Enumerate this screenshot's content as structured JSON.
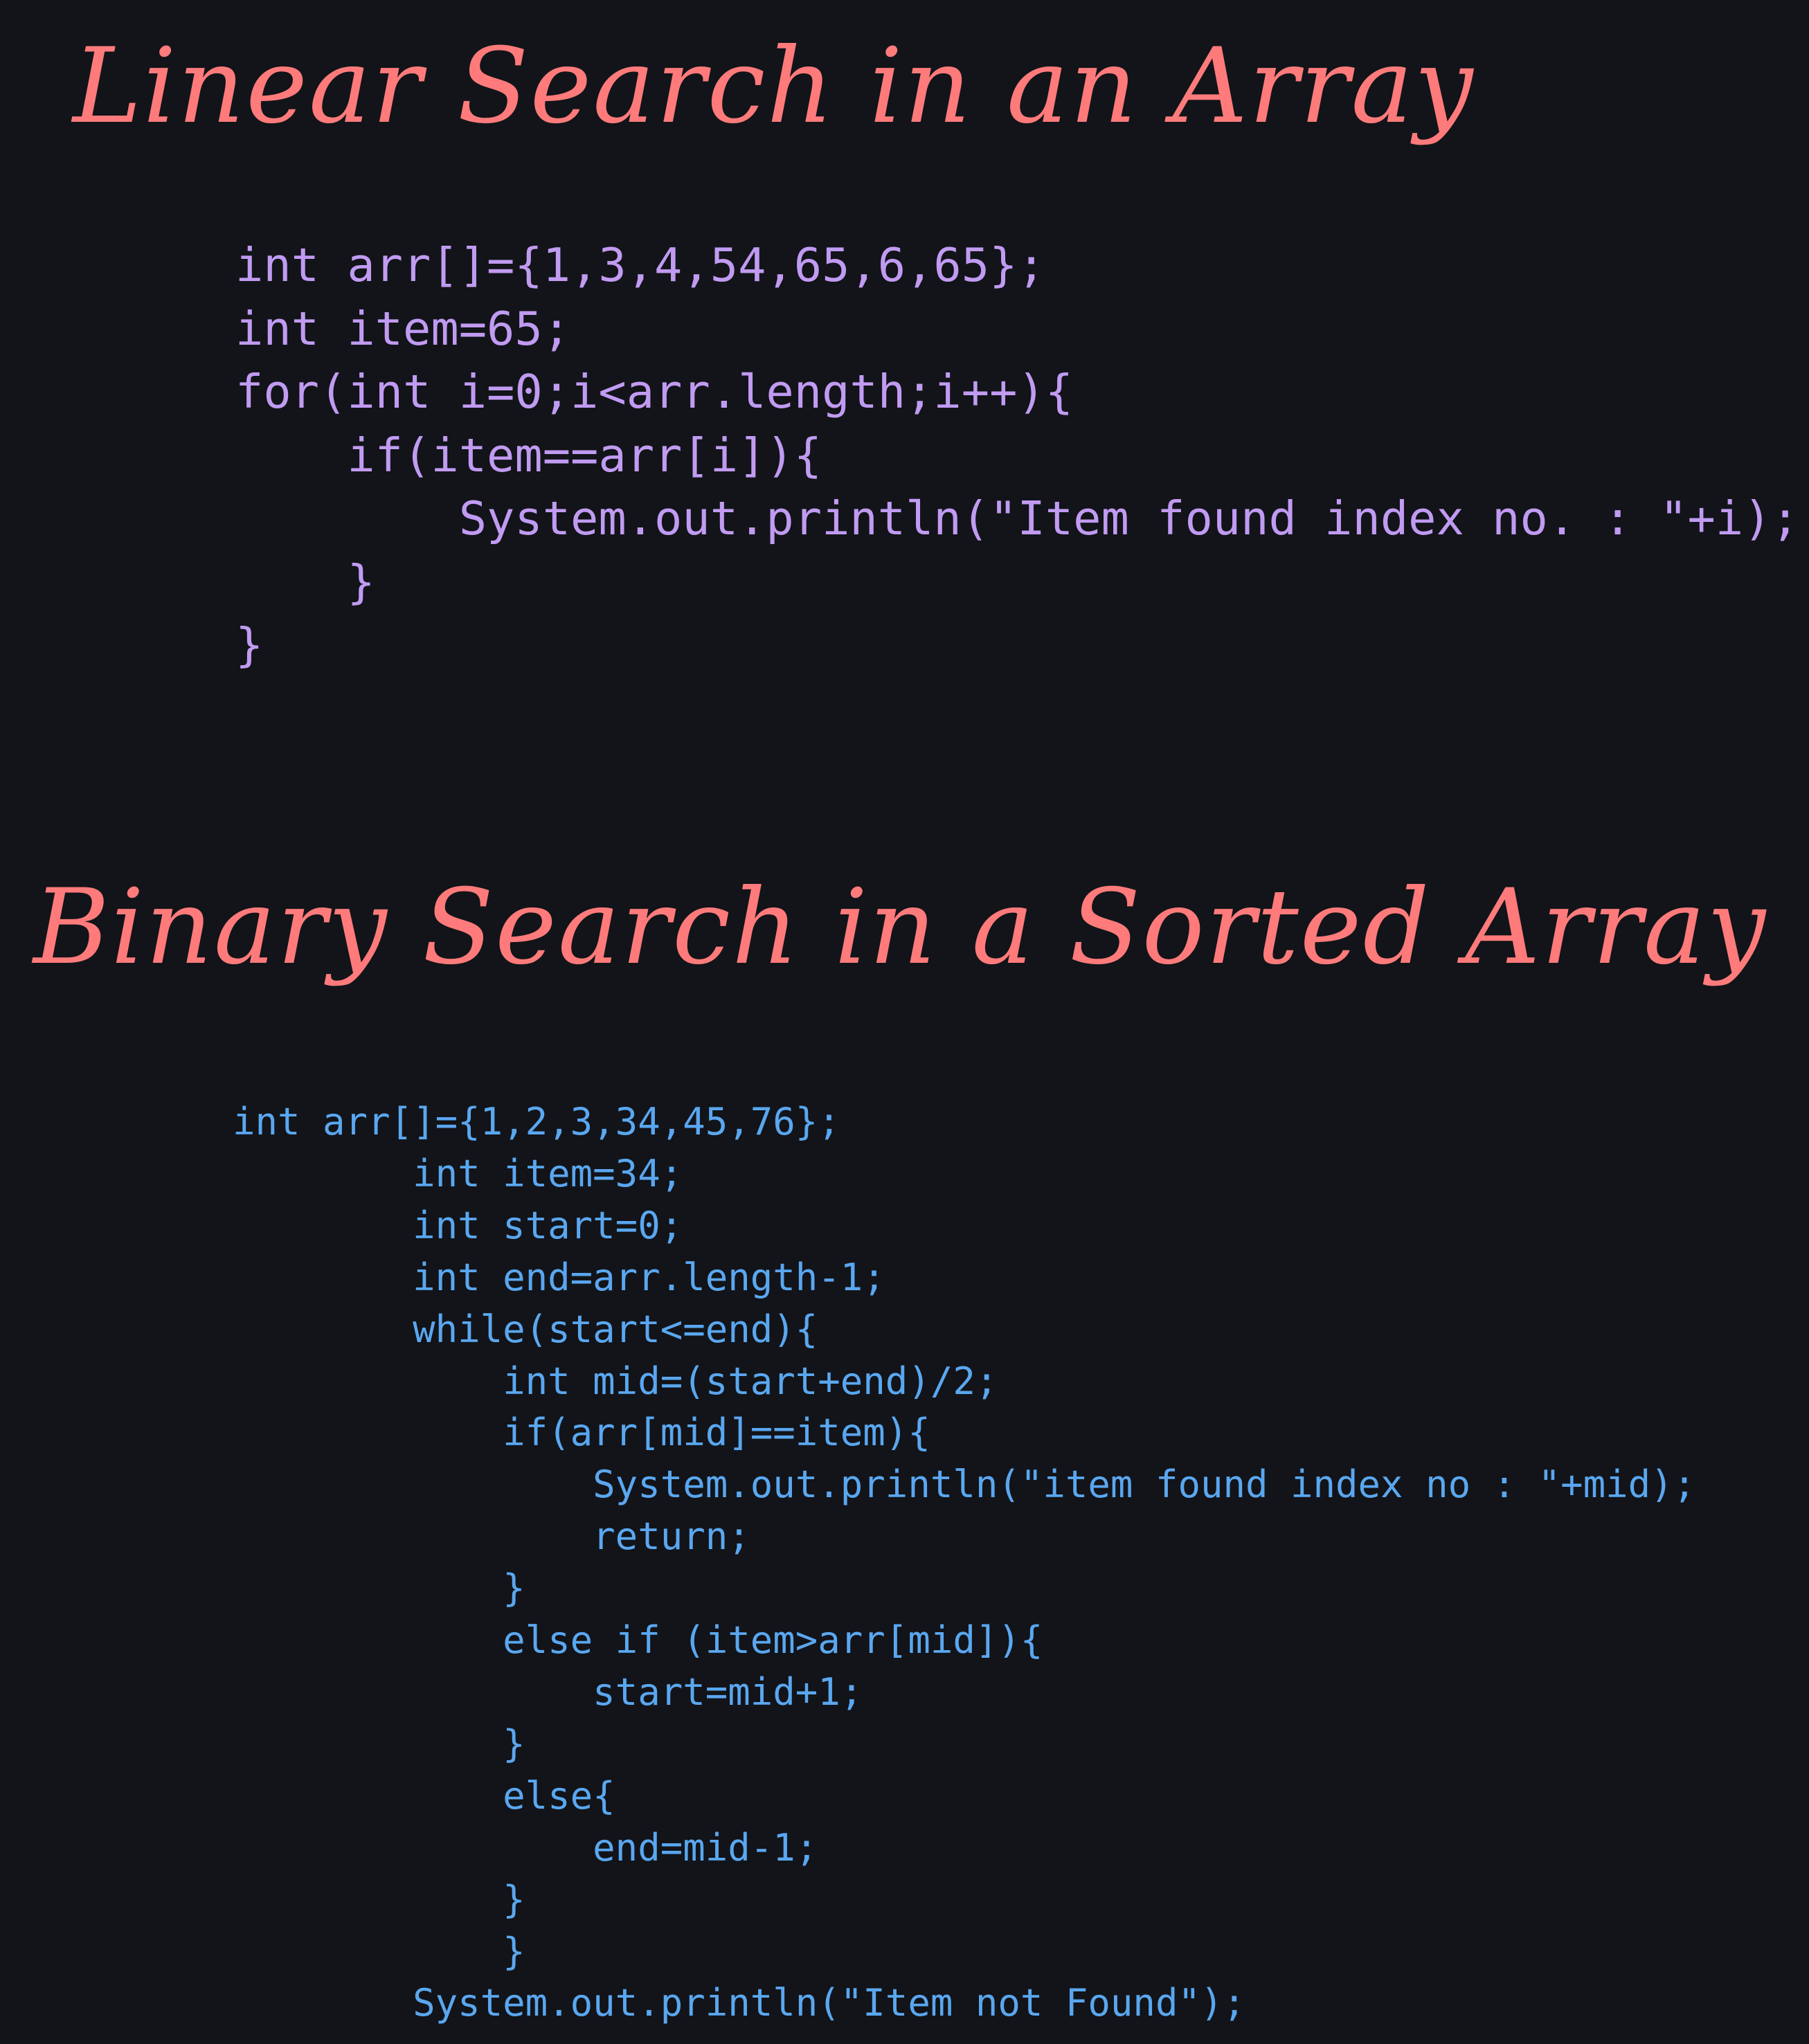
{
  "linear": {
    "title": "Linear Search in an Array",
    "code_lines": [
      "int arr[]={1,3,4,54,65,6,65};",
      "",
      "int item=65;",
      "",
      "for(int i=0;i<arr.length;i++){",
      "    if(item==arr[i]){",
      "        System.out.println(\"Item found index no. : \"+i);",
      "    }",
      "}"
    ]
  },
  "binary": {
    "title": "Binary Search in a Sorted Array",
    "code_lines": [
      "int arr[]={1,2,3,34,45,76};",
      "        int item=34;",
      "        int start=0;",
      "        int end=arr.length-1;",
      "        while(start<=end){",
      "            int mid=(start+end)/2;",
      "            if(arr[mid]==item){",
      "                System.out.println(\"item found index no : \"+mid);",
      "                return;",
      "            }",
      "            else if (item>arr[mid]){",
      "                start=mid+1;",
      "            }",
      "            else{",
      "                end=mid-1;",
      "            }",
      "            }",
      "        System.out.println(\"Item not Found\");"
    ]
  },
  "colors": {
    "background": "#121419",
    "title": "#ff7b7b",
    "linear_code": "#c19bf2",
    "binary_code": "#5aa7f0"
  }
}
